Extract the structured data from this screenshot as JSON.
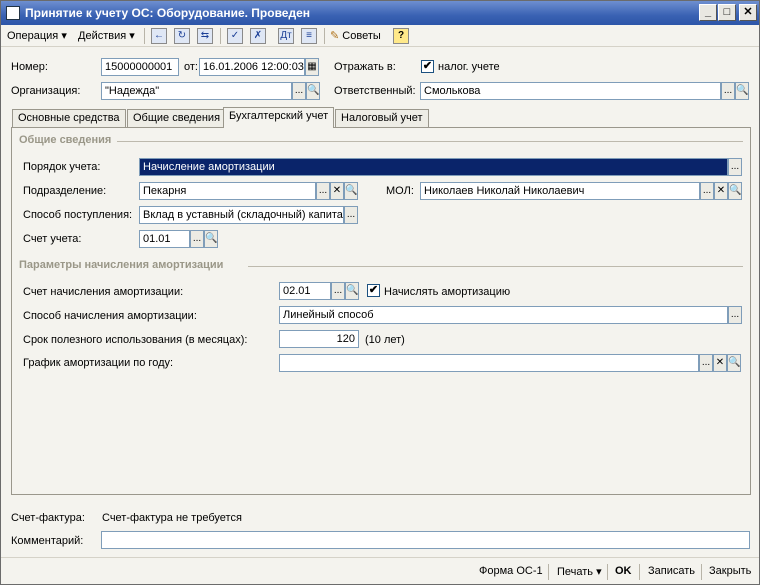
{
  "window": {
    "title": "Принятие к учету ОС: Оборудование. Проведен",
    "minimize": "_",
    "maximize": "□",
    "close": "✕"
  },
  "toolbar": {
    "operation": "Операция",
    "actions": "Действия",
    "arrow": "▾",
    "tips": "Советы",
    "help": "?"
  },
  "header": {
    "number_label": "Номер:",
    "number_value": "15000000001",
    "date_label": "от:",
    "date_value": "16.01.2006 12:00:03",
    "reflect_label": "Отражать в:",
    "tax_check": "✔",
    "tax_label": "налог. учете",
    "org_label": "Организация:",
    "org_value": "\"Надежда\"",
    "resp_label": "Ответственный:",
    "resp_value": "Смолькова"
  },
  "tabs": [
    {
      "label": "Основные средства"
    },
    {
      "label": "Общие сведения"
    },
    {
      "label": "Бухгалтерский учет"
    },
    {
      "label": "Налоговый учет"
    }
  ],
  "general": {
    "title": "Общие сведения",
    "order_label": "Порядок учета:",
    "order_value": "Начисление амортизации",
    "dept_label": "Подразделение:",
    "dept_value": "Пекарня",
    "mol_label": "МОЛ:",
    "mol_value": "Николаев Николай Николаевич",
    "receipt_label": "Способ поступления:",
    "receipt_value": "Вклад в уставный (складочный) капитал",
    "account_label": "Счет учета:",
    "account_value": "01.01"
  },
  "depreciation": {
    "title": "Параметры начисления амортизации",
    "account_label": "Счет начисления амортизации:",
    "account_value": "02.01",
    "accrue_check": "✔",
    "accrue_label": "Начислять амортизацию",
    "method_label": "Способ начисления амортизации:",
    "method_value": "Линейный способ",
    "term_label": "Срок полезного использования (в месяцах):",
    "term_value": "120",
    "term_note": "(10 лет)",
    "schedule_label": "График амортизации по году:",
    "schedule_value": ""
  },
  "bottom": {
    "invoice_label": "Счет-фактура:",
    "invoice_value": "Счет-фактура не требуется",
    "comment_label": "Комментарий:",
    "comment_value": ""
  },
  "footer": {
    "form": "Форма ОС-1",
    "print": "Печать",
    "print_arrow": "▾",
    "ok": "OK",
    "save": "Записать",
    "close": "Закрыть"
  },
  "buttons": {
    "dots": "...",
    "search": "🔍",
    "clear": "✕",
    "calendar": "▦"
  }
}
